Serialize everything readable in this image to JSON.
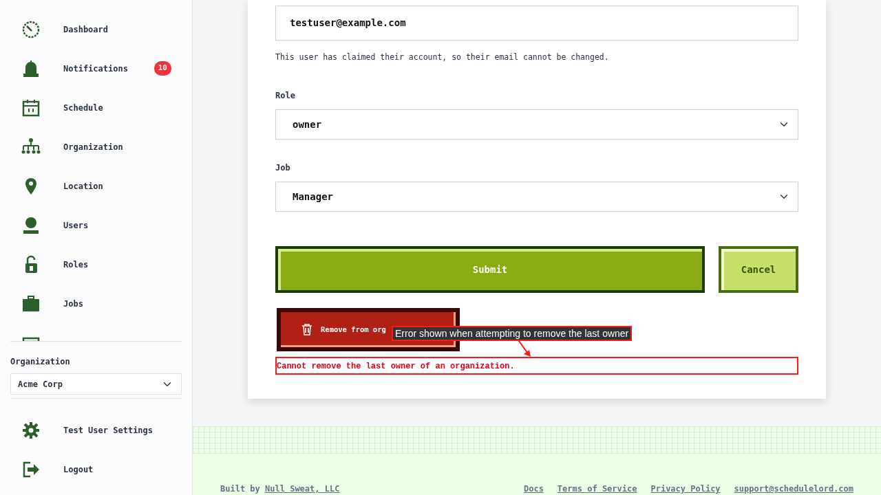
{
  "sidebar": {
    "items": [
      {
        "label": "Dashboard"
      },
      {
        "label": "Notifications",
        "badge": "10"
      },
      {
        "label": "Schedule"
      },
      {
        "label": "Organization"
      },
      {
        "label": "Location"
      },
      {
        "label": "Users"
      },
      {
        "label": "Roles"
      },
      {
        "label": "Jobs"
      }
    ],
    "org_label": "Organization",
    "org_select": "Acme Corp",
    "bottom_items": [
      {
        "label": "Test User Settings"
      },
      {
        "label": "Logout"
      }
    ]
  },
  "form": {
    "email": "testuser@example.com",
    "email_help": "This user has claimed their account, so their email cannot be changed.",
    "fields": [
      {
        "label": "Role",
        "value": "owner"
      },
      {
        "label": "Job",
        "value": "Manager"
      }
    ],
    "submit": "Submit",
    "cancel": "Cancel",
    "remove": "Remove from org",
    "error": "Cannot remove the last owner of an organization."
  },
  "annotation": "Error shown when attempting to remove the last owner",
  "footer": {
    "built_by": "Built by",
    "company": "Null Sweat, LLC",
    "links": [
      "Docs",
      "Terms of Service",
      "Privacy Policy",
      "support@schedulelord.com"
    ]
  }
}
